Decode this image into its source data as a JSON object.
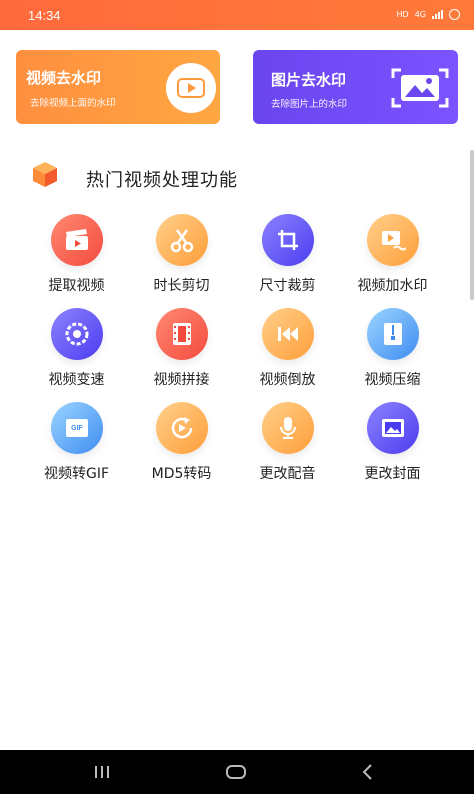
{
  "status_bar": {
    "time": "14:34",
    "indicators": [
      "HD",
      "4G",
      "signal-icon",
      "battery-icon"
    ]
  },
  "banners": [
    {
      "title": "视频去水印",
      "subtitle": "去除视频上面的水印",
      "icon": "play-icon",
      "color": "#ff9a3e"
    },
    {
      "title": "图片去水印",
      "subtitle": "去除图片上的水印",
      "icon": "photo-icon",
      "color": "#6b47f0"
    }
  ],
  "section": {
    "title": "热门视频处理功能",
    "icon": "cube-icon"
  },
  "features": [
    {
      "label": "提取视频",
      "icon": "clapper-icon",
      "color": "red"
    },
    {
      "label": "时长剪切",
      "icon": "scissors-icon",
      "color": "orange"
    },
    {
      "label": "尺寸裁剪",
      "icon": "crop-icon",
      "color": "purple"
    },
    {
      "label": "视频加水印",
      "icon": "video-watermark-icon",
      "color": "orange"
    },
    {
      "label": "视频变速",
      "icon": "speed-icon",
      "color": "purple"
    },
    {
      "label": "视频拼接",
      "icon": "film-icon",
      "color": "red"
    },
    {
      "label": "视频倒放",
      "icon": "rewind-icon",
      "color": "orange"
    },
    {
      "label": "视频压缩",
      "icon": "compress-icon",
      "color": "blue"
    },
    {
      "label": "视频转GIF",
      "icon": "gif-icon",
      "color": "blue"
    },
    {
      "label": "MD5转码",
      "icon": "md5-icon",
      "color": "orange"
    },
    {
      "label": "更改配音",
      "icon": "microphone-icon",
      "color": "orange"
    },
    {
      "label": "更改封面",
      "icon": "cover-image-icon",
      "color": "purple"
    }
  ],
  "nav_bar": {
    "buttons": [
      "recents-icon",
      "home-icon",
      "back-icon"
    ]
  }
}
